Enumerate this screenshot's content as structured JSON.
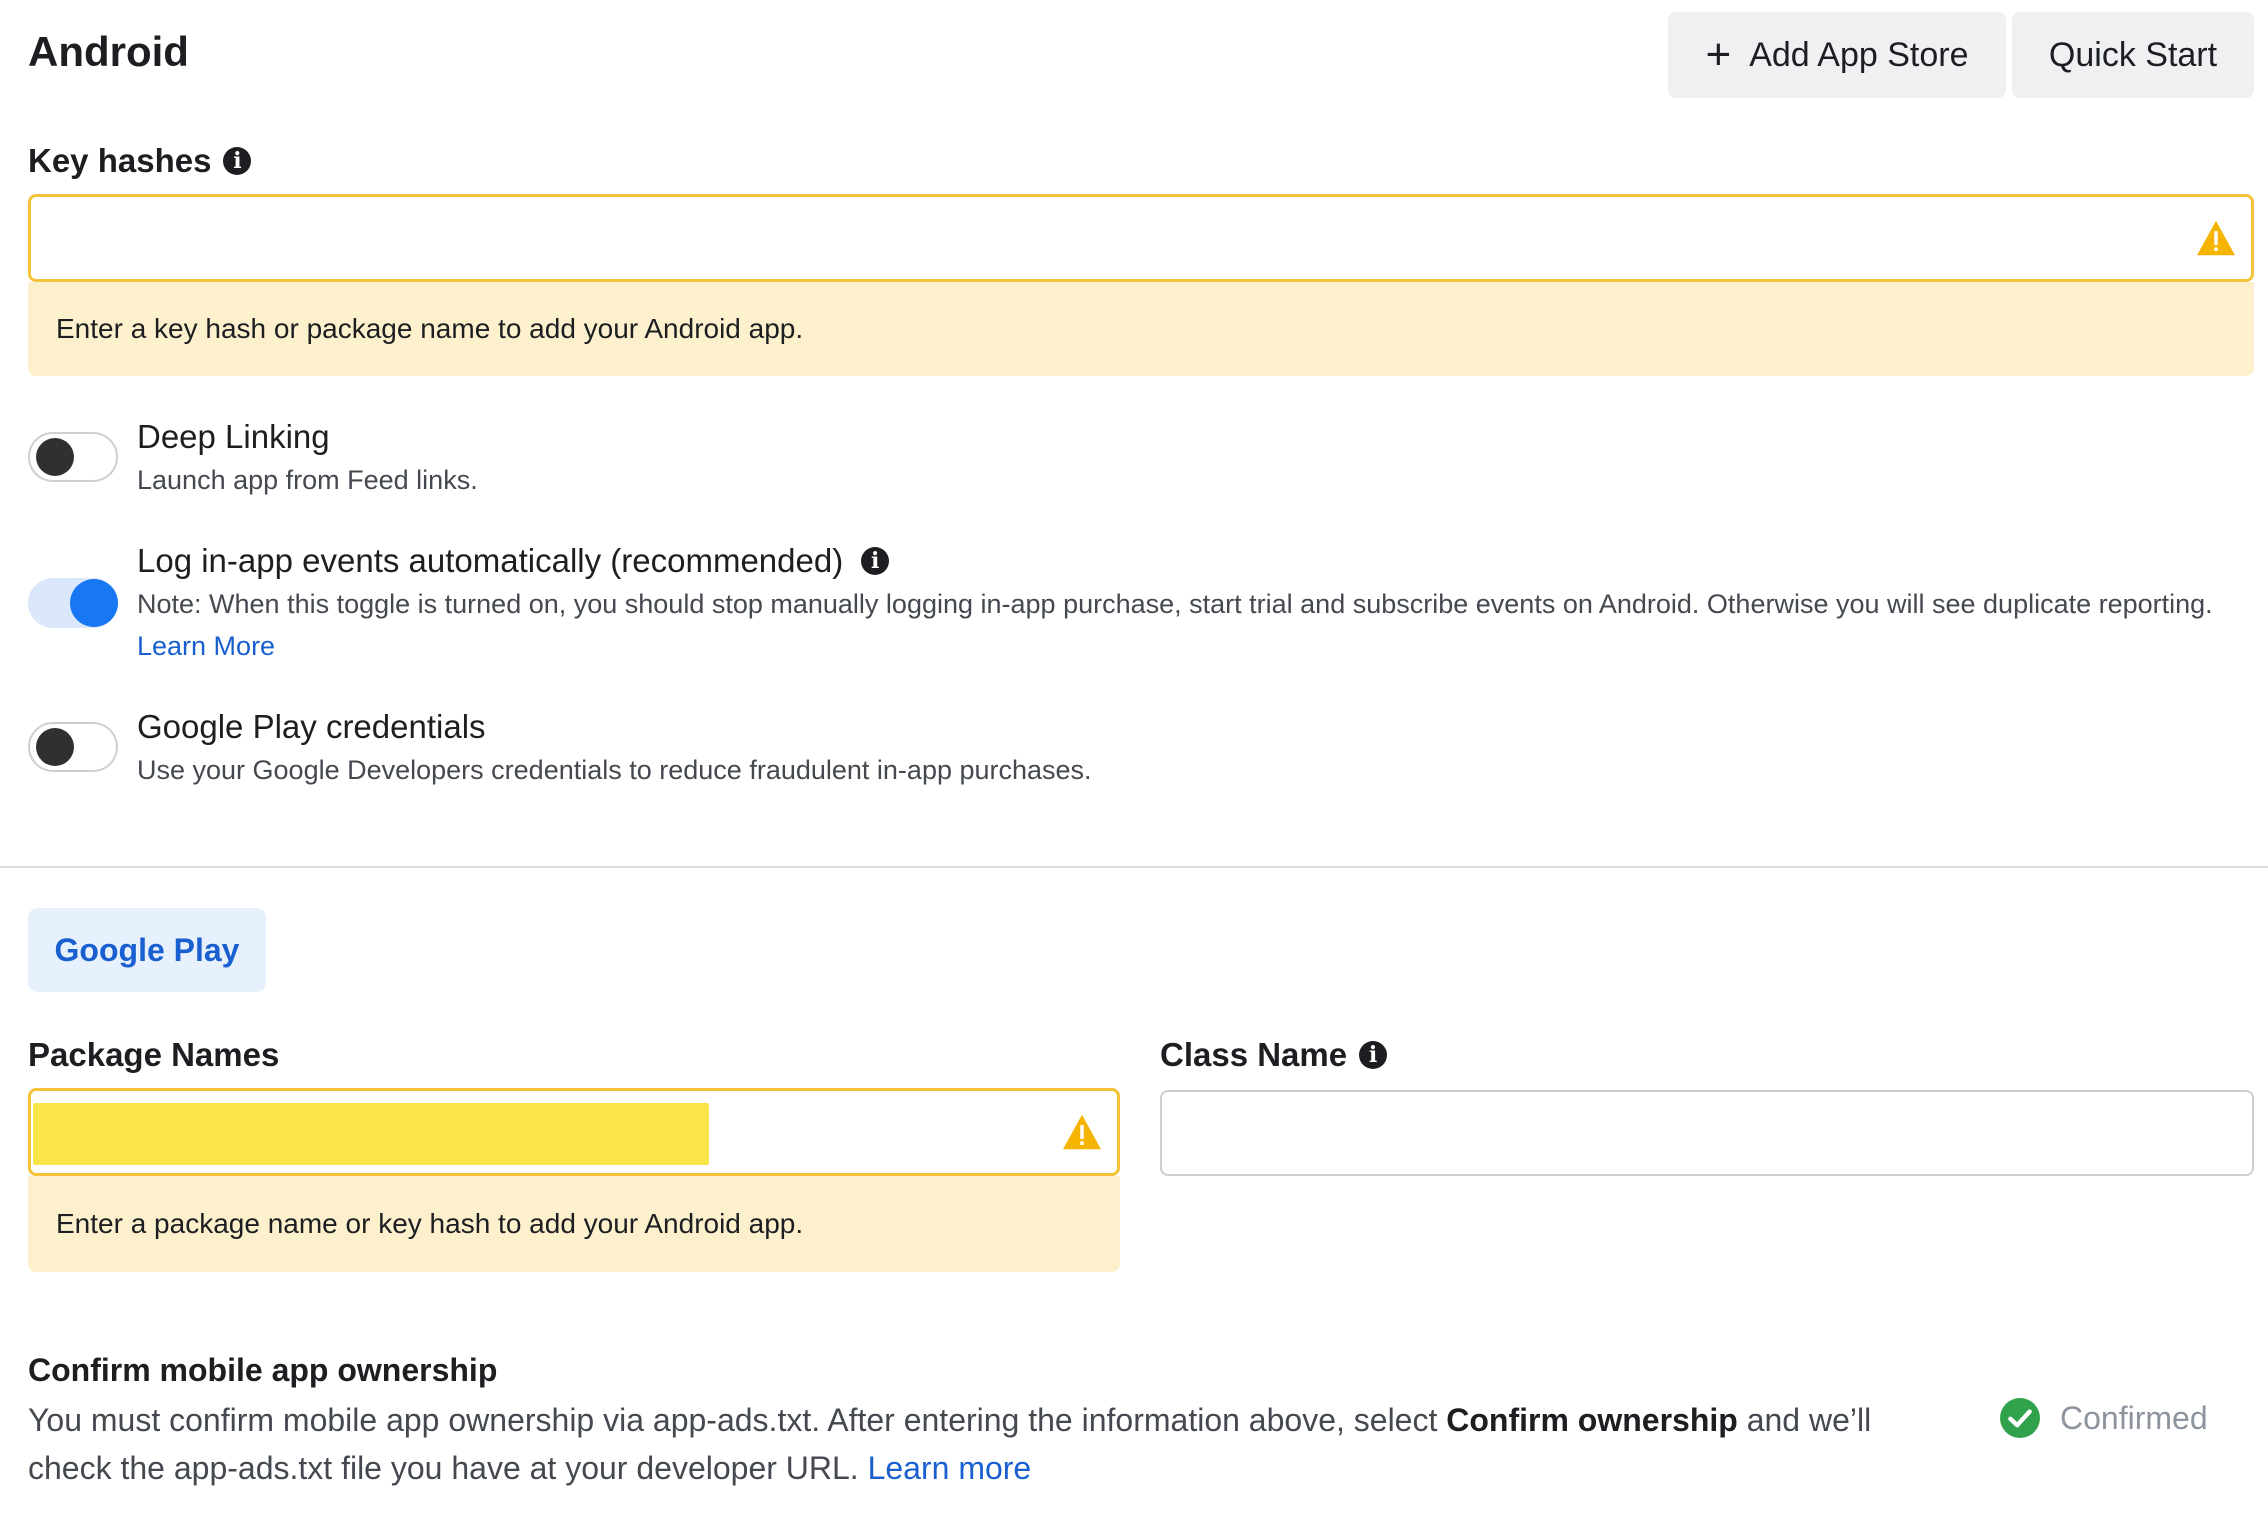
{
  "header": {
    "title": "Android",
    "add_app_store_label": "Add App Store",
    "quick_start_label": "Quick Start"
  },
  "key_hashes": {
    "label": "Key hashes",
    "value": "",
    "warning": "Enter a key hash or package name to add your Android app."
  },
  "options": [
    {
      "title": "Deep Linking",
      "description": "Launch app from Feed links.",
      "enabled": false
    },
    {
      "title": "Log in-app events automatically (recommended)",
      "description": "Note: When this toggle is turned on, you should stop manually logging in-app purchase, start trial and subscribe events on Android. Otherwise you will see duplicate reporting.",
      "link": "Learn More",
      "enabled": true
    },
    {
      "title": "Google Play credentials",
      "description": "Use your Google Developers credentials to reduce fraudulent in-app purchases.",
      "enabled": false
    }
  ],
  "store_tab": {
    "label": "Google Play"
  },
  "package_names": {
    "label": "Package Names",
    "warning": "Enter a package name or key hash to add your Android app."
  },
  "class_name": {
    "label": "Class Name",
    "value": ""
  },
  "ownership": {
    "title": "Confirm mobile app ownership",
    "text_part1": "You must confirm mobile app ownership via app-ads.txt. After entering the information above, select ",
    "text_bold": "Confirm ownership",
    "text_part2": " and we’ll check the app-ads.txt file you have at your developer URL.",
    "link": "Learn more",
    "status": "Confirmed"
  },
  "colors": {
    "accent_blue": "#1877f2",
    "link_blue": "#1a5fcf",
    "warning_yellow": "#f5c33b",
    "warning_bg": "#fdf0cd",
    "success_green": "#31a24c"
  }
}
